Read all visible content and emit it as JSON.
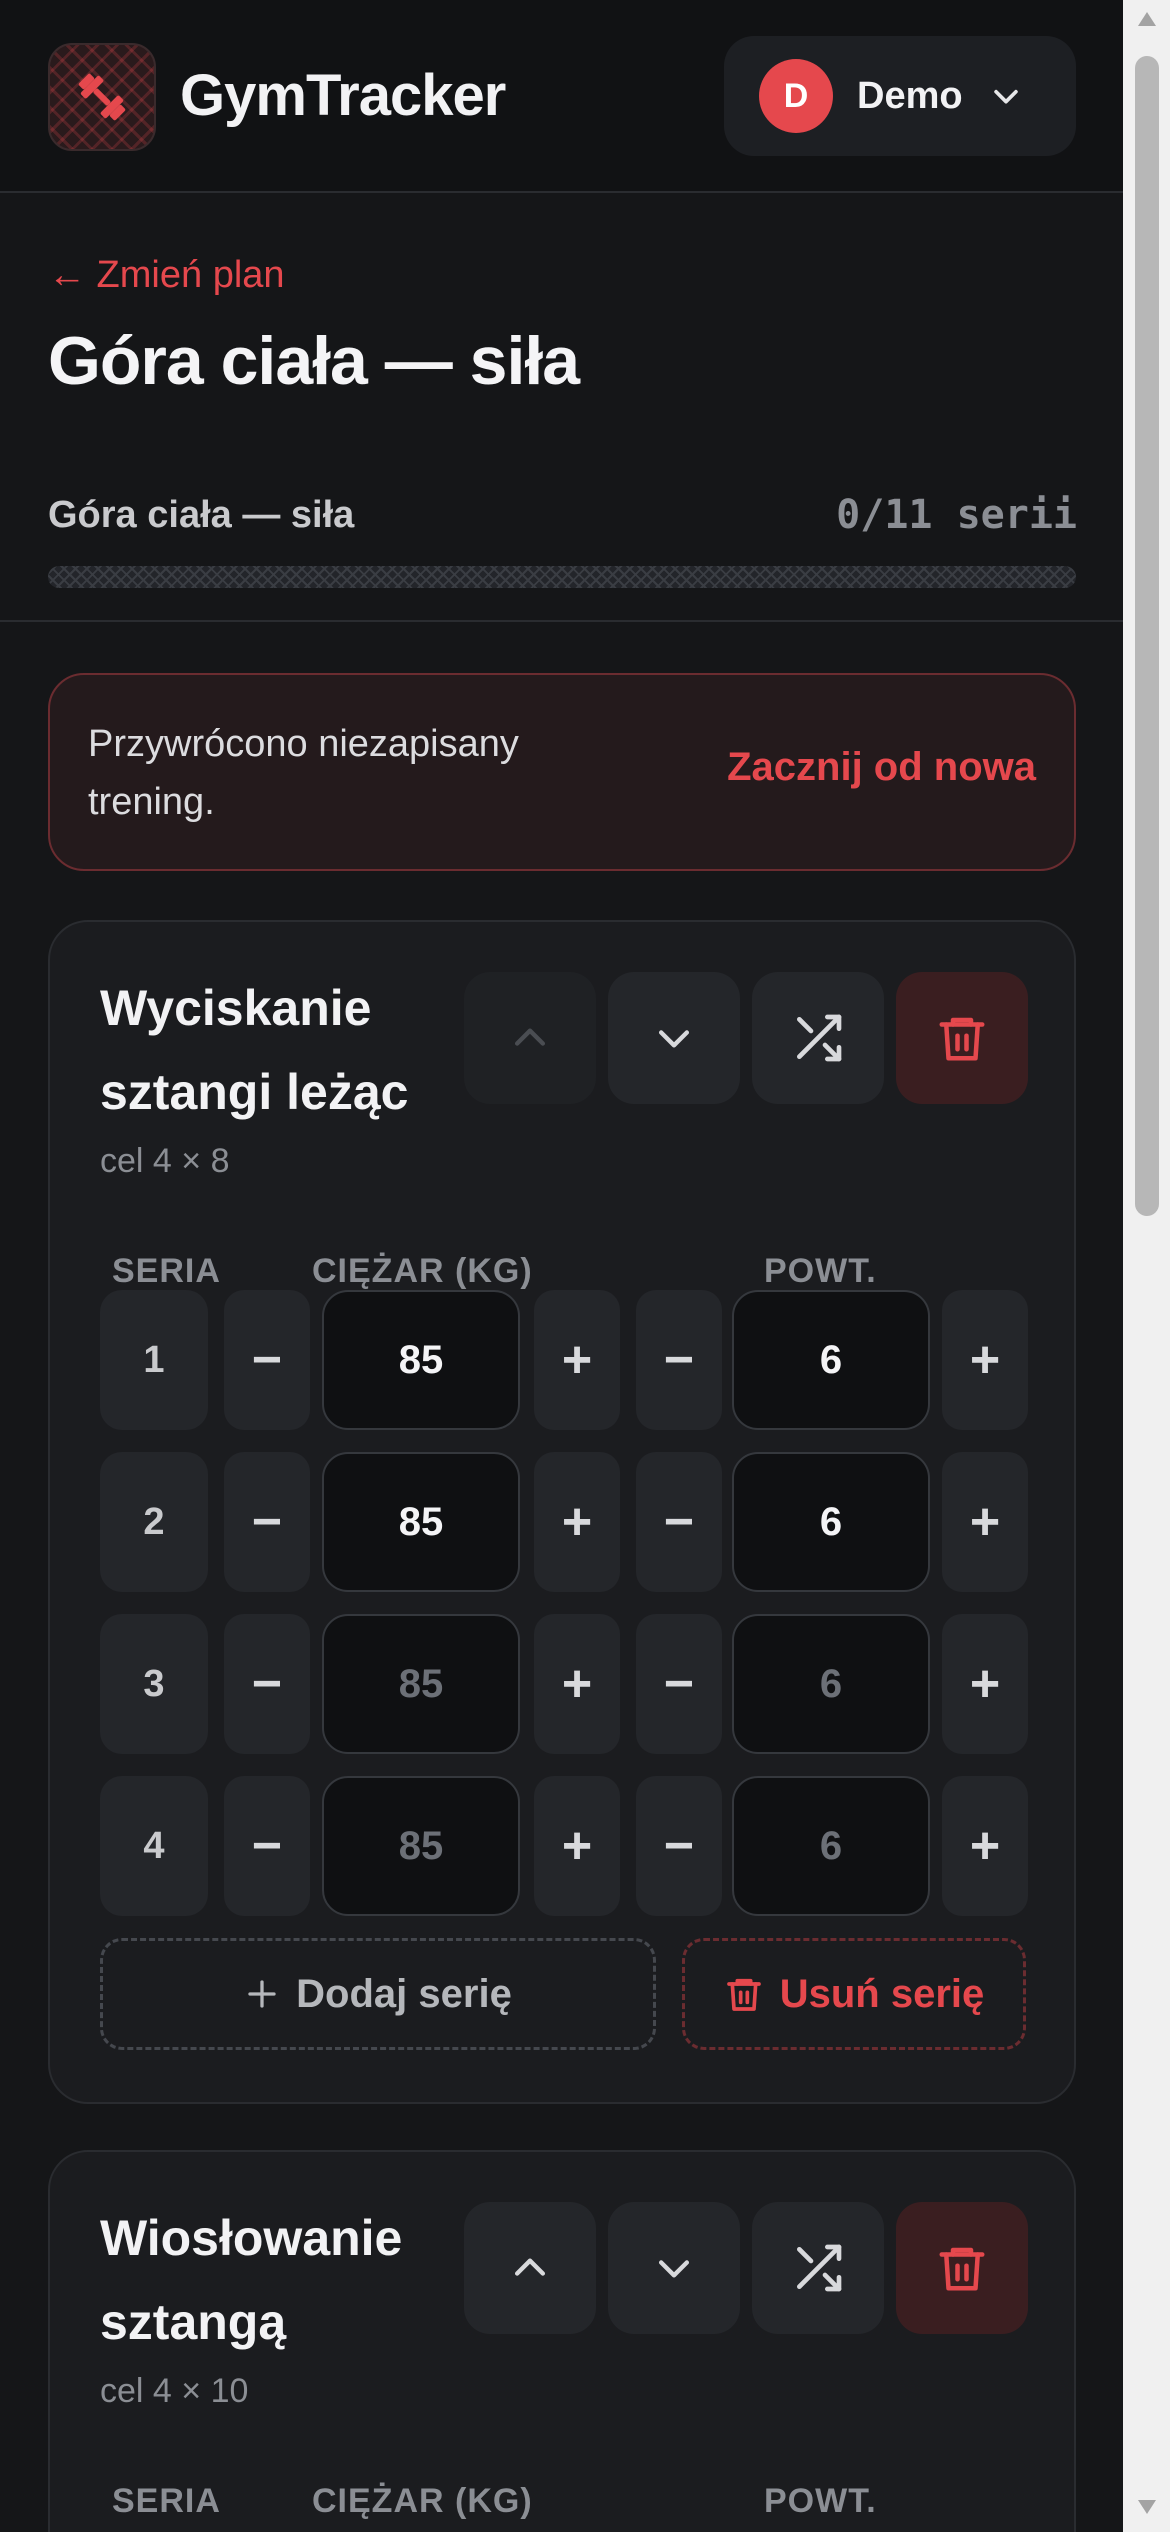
{
  "header": {
    "brand": "GymTracker",
    "user_initial": "D",
    "user_name": "Demo"
  },
  "page": {
    "back_label": "← Zmień plan",
    "title": "Góra ciała — siła",
    "progress_label": "Góra ciała — siła",
    "progress_count": "0/11 serii",
    "progress_fraction": 0
  },
  "notice": {
    "text": "Przywrócono niezapisany trening.",
    "action": "Zacznij od nowa"
  },
  "columns": {
    "set": "SERIA",
    "weight": "CIĘŻAR (KG)",
    "reps": "POWT."
  },
  "controls": {
    "minus": "−",
    "plus": "+",
    "add_set": "Dodaj serię",
    "remove_set": "Usuń serię"
  },
  "exercises": [
    {
      "name": "Wyciskanie sztangi leżąc",
      "target": "cel 4 × 8",
      "move_up_disabled": true,
      "sets": [
        {
          "num": "1",
          "weight": "85",
          "reps": "6",
          "filled": true
        },
        {
          "num": "2",
          "weight": "85",
          "reps": "6",
          "filled": true
        },
        {
          "num": "3",
          "weight": "85",
          "reps": "6",
          "filled": false
        },
        {
          "num": "4",
          "weight": "85",
          "reps": "6",
          "filled": false
        }
      ]
    },
    {
      "name": "Wiosłowanie sztangą",
      "target": "cel 4 × 10",
      "move_up_disabled": false,
      "sets": []
    }
  ],
  "colors": {
    "accent": "#e5484d",
    "background": "#151618",
    "card": "#1b1c1f"
  }
}
